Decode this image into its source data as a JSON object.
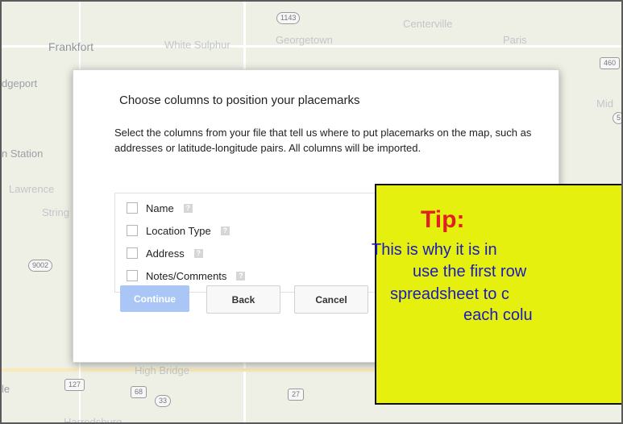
{
  "map": {
    "places": [
      "Frankfort",
      "White Sulphur",
      "Georgetown",
      "Centerville",
      "Paris",
      "dgeport",
      "Mid",
      "n Station",
      "Lawrence",
      "String",
      "High Bridge",
      "Harrodsburg",
      "le"
    ],
    "shields": [
      "1143",
      "460",
      "5",
      "9002",
      "127",
      "68",
      "33",
      "27"
    ]
  },
  "dialog": {
    "title": "Choose columns to position your placemarks",
    "description": "Select the columns from your file that tell us where to put placemarks on the map, such as addresses or latitude-longitude pairs. All columns will be imported.",
    "columns": [
      "Name",
      "Location Type",
      "Address",
      "Notes/Comments"
    ],
    "help_glyph": "?",
    "buttons": {
      "continue": "Continue",
      "back": "Back",
      "cancel": "Cancel"
    }
  },
  "tip": {
    "title": "Tip:",
    "lines": [
      "This is why it is in",
      "use the first row",
      "spreadsheet to c",
      "each colu"
    ]
  },
  "colors": {
    "tip_bg": "#e6f00e",
    "tip_title": "#e0211f",
    "tip_text": "#1a1abf",
    "continue_bg": "#a9c6f7"
  }
}
